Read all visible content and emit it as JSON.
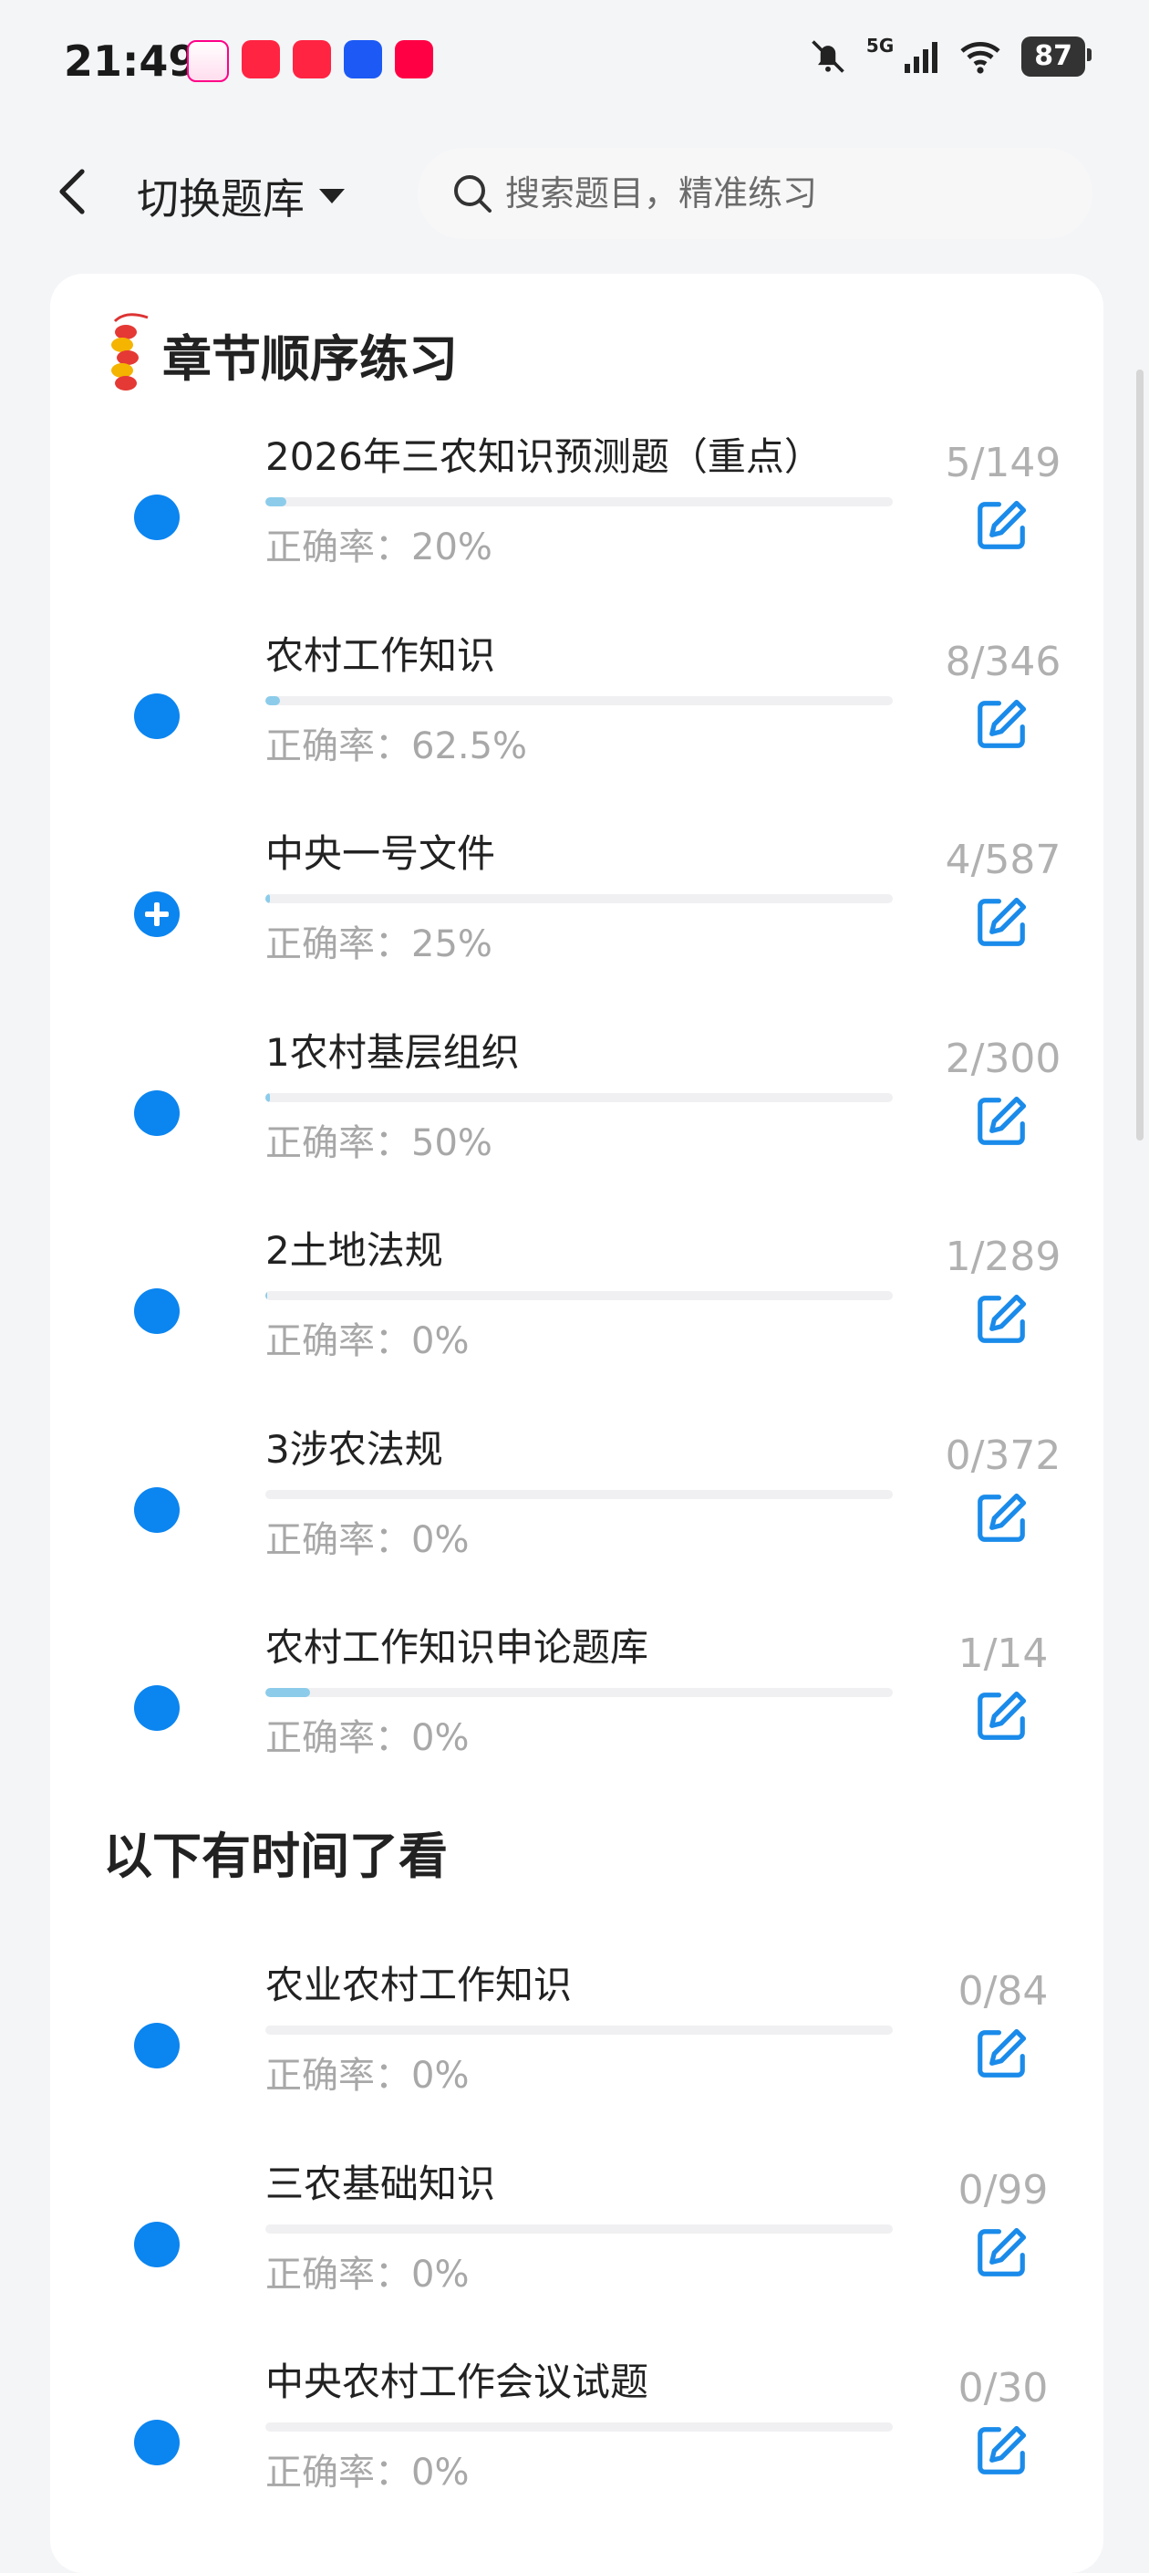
{
  "status_bar": {
    "time": "21:49",
    "network": "5G",
    "battery": "87"
  },
  "header": {
    "back_icon": "chevron-left-icon",
    "switch_label": "切换题库",
    "search_placeholder": "搜索题目，精准练习"
  },
  "colors": {
    "accent": "#0b85f0",
    "progress": "#8cccea",
    "muted_text": "#a8a8a8"
  },
  "section1": {
    "title": "章节顺序练习",
    "items": [
      {
        "title": "2026年三农知识预测题（重点）",
        "accuracy": "正确率：20%",
        "count": "5/149",
        "progress": 0.034,
        "icon": "dot"
      },
      {
        "title": "农村工作知识",
        "accuracy": "正确率：62.5%",
        "count": "8/346",
        "progress": 0.023,
        "icon": "dot"
      },
      {
        "title": "中央一号文件",
        "accuracy": "正确率：25%",
        "count": "4/587",
        "progress": 0.007,
        "icon": "plus"
      },
      {
        "title": "1农村基层组织",
        "accuracy": "正确率：50%",
        "count": "2/300",
        "progress": 0.007,
        "icon": "dot"
      },
      {
        "title": "2土地法规",
        "accuracy": "正确率：0%",
        "count": "1/289",
        "progress": 0.003,
        "icon": "dot"
      },
      {
        "title": "3涉农法规",
        "accuracy": "正确率：0%",
        "count": "0/372",
        "progress": 0,
        "icon": "dot"
      },
      {
        "title": "农村工作知识申论题库",
        "accuracy": "正确率：0%",
        "count": "1/14",
        "progress": 0.071,
        "icon": "dot"
      }
    ]
  },
  "section2": {
    "title": "以下有时间了看",
    "items": [
      {
        "title": "农业农村工作知识",
        "accuracy": "正确率：0%",
        "count": "0/84",
        "progress": 0,
        "icon": "dot"
      },
      {
        "title": "三农基础知识",
        "accuracy": "正确率：0%",
        "count": "0/99",
        "progress": 0,
        "icon": "dot"
      },
      {
        "title": "中央农村工作会议试题",
        "accuracy": "正确率：0%",
        "count": "0/30",
        "progress": 0,
        "icon": "dot"
      }
    ]
  }
}
